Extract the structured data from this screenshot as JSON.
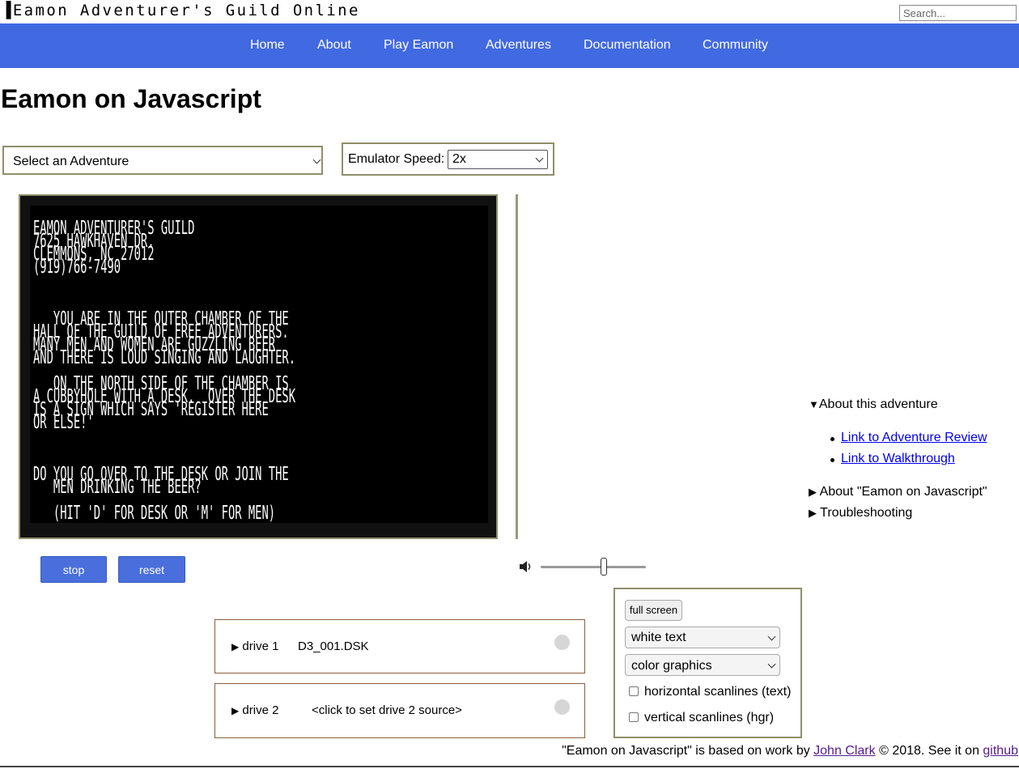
{
  "header": {
    "site_title": "▐Eamon Adventurer's Guild Online",
    "search_placeholder": "Search..."
  },
  "nav": {
    "items": [
      {
        "label": "Home"
      },
      {
        "label": "About"
      },
      {
        "label": "Play Eamon"
      },
      {
        "label": "Adventures"
      },
      {
        "label": "Documentation"
      },
      {
        "label": "Community"
      }
    ]
  },
  "main": {
    "title": "Eamon on Javascript",
    "adventure_select": {
      "value": "Select an Adventure"
    },
    "speed": {
      "label": "Emulator Speed:",
      "value": "2x"
    },
    "screen_lines": [
      "EAMON ADVENTURER'S GUILD",
      "7625 HAWKHAVEN DR.",
      "CLEMMONS, NC 27012",
      "(919)766-7490",
      "",
      "",
      "",
      "   YOU ARE IN THE OUTER CHAMBER OF THE",
      "HALL OF THE GUILD OF FREE ADVENTURERS.",
      "MANY MEN AND WOMEN ARE GUZZLING BEER",
      "AND THERE IS LOUD SINGING AND LAUGHTER.",
      "",
      "   ON THE NORTH SIDE OF THE CHAMBER IS",
      "A CUBBYHOLE WITH A DESK.  OVER THE DESK",
      "IS A SIGN WHICH SAYS 'REGISTER HERE",
      "OR ELSE!'",
      "",
      "",
      "",
      "DO YOU GO OVER TO THE DESK OR JOIN THE",
      "   MEN DRINKING THE BEER?",
      "",
      "   (HIT 'D' FOR DESK OR 'M' FOR MEN)"
    ],
    "stop_label": "stop",
    "reset_label": "reset",
    "volume_level": 0.6
  },
  "sidebar": {
    "about_adventure": "About this adventure",
    "links": [
      "Link to Adventure Review",
      "Link to Walkthrough"
    ],
    "about_eamon_js": "About \"Eamon on Javascript\"",
    "troubleshooting": "Troubleshooting"
  },
  "drives": [
    {
      "label": "drive 1",
      "source": "D3_001.DSK"
    },
    {
      "label": "drive 2",
      "source": "<click to set drive 2 source>"
    }
  ],
  "display_options": {
    "full_screen_label": "full screen",
    "text_color": "white text",
    "graphics_mode": "color graphics",
    "horizontal_scanlines": "horizontal scanlines (text)",
    "vertical_scanlines": "vertical scanlines (hgr)"
  },
  "footer": {
    "prefix": "\"Eamon on Javascript\" is based on work by ",
    "author_link": "John Clark",
    "middle": " © 2018. See it on ",
    "repo_link": "github"
  },
  "colors": {
    "nav_bg": "#4169e1",
    "button_bg": "#4a6fdc",
    "box_border": "#8f8f6a",
    "drive_border": "#8b5e3c",
    "link": "#0000ee"
  }
}
